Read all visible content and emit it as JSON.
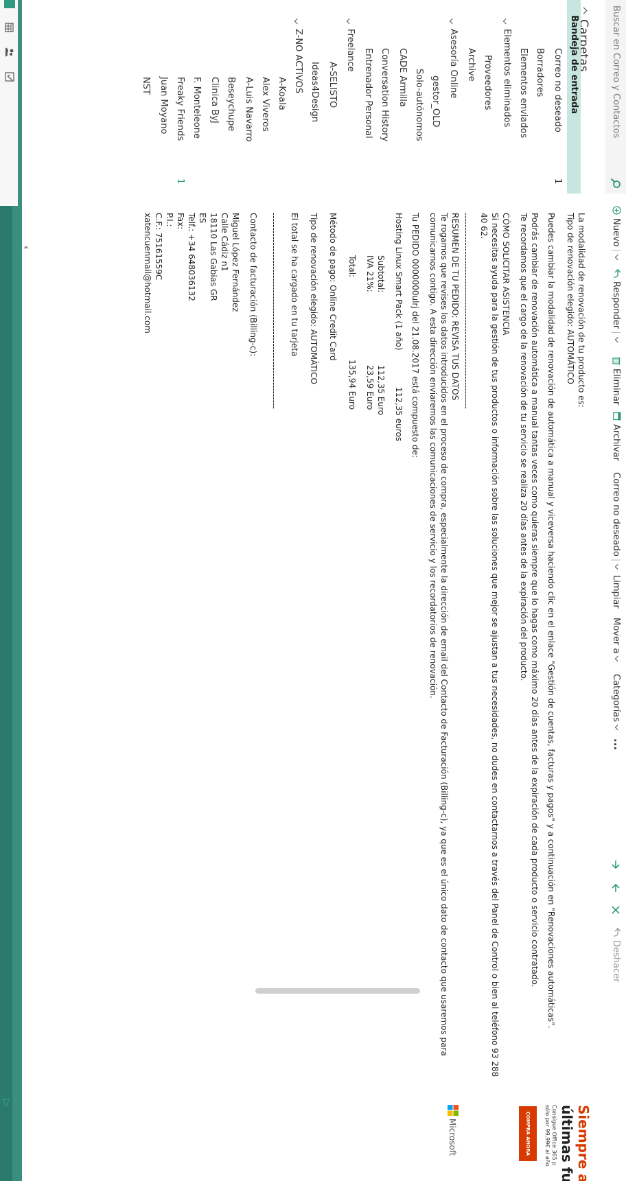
{
  "search": {
    "placeholder": "Buscar en Correo y Contactos"
  },
  "toolbar": {
    "new_label": "Nuevo",
    "reply_label": "Responder",
    "delete_label": "Eliminar",
    "archive_label": "Archivar",
    "junk_label": "Correo no deseado",
    "sweep_label": "Limpiar",
    "move_label": "Mover a",
    "categories_label": "Categorías",
    "more_label": "...",
    "undo_label": "Deshacer"
  },
  "folders": {
    "header": "Carpetas",
    "items": [
      {
        "label": "Bandeja de entrada",
        "count": "",
        "selected": true
      },
      {
        "label": "Correo no deseado",
        "count": "1"
      },
      {
        "label": "Borradores",
        "count": ""
      },
      {
        "label": "Elementos enviados",
        "count": ""
      },
      {
        "label": "Elementos eliminados",
        "count": ""
      },
      {
        "label": "Proveedores",
        "count": ""
      },
      {
        "label": "Archive",
        "count": ""
      },
      {
        "label": "Asesoría Online",
        "count": ""
      },
      {
        "label": "gestor_OLD",
        "count": ""
      },
      {
        "label": "Solo-autónomos",
        "count": ""
      },
      {
        "label": "CADE Armilla",
        "count": ""
      },
      {
        "label": "Conversation History",
        "count": ""
      },
      {
        "label": "Entrenador Personal",
        "count": ""
      },
      {
        "label": "Freelance",
        "count": ""
      },
      {
        "label": "A-SELISTO",
        "count": ""
      },
      {
        "label": "Ideas4Design",
        "count": ""
      },
      {
        "label": "Z-NO ACTIVOS",
        "count": ""
      },
      {
        "label": "A-Koala",
        "count": ""
      },
      {
        "label": "Alex Viveros",
        "count": ""
      },
      {
        "label": "A-Luis Navarro",
        "count": ""
      },
      {
        "label": "Beseychupe",
        "count": ""
      },
      {
        "label": "Clinica ByJ",
        "count": ""
      },
      {
        "label": "F. Monteleone",
        "count": ""
      },
      {
        "label": "Freaky Friends",
        "count": "1"
      },
      {
        "label": "Juan Moyano",
        "count": ""
      },
      {
        "label": "NST",
        "count": ""
      }
    ]
  },
  "email": {
    "lines": [
      "La modalidad de renovación de tu producto es:",
      "Tipo de renovación elegido: AUTOMÁTICO",
      "Puedes cambiar la modalidad de renovación de automática a manual y viceversa haciendo clic en el enlace \"Gestión de cuentas, facturas y pagos\" y a continuación en \"Renovaciones automáticas\".",
      "Podrás cambiar de renovación automática a manual tantas veces como quieras siempre que lo hagas como máximo 20 días antes de la expiración de cada producto o servicio contratado.",
      "Te recordamos que el cargo de la renovación de tu servicio se realiza 20 días antes de la expiración del producto.",
      "CÓMO SOLICITAR ASISTENCIA",
      "Si necesitas ayuda para la gestión de tus productos o información sobre las soluciones que mejor se ajustan a tus necesidades, no dudes en contactarnos a través del Panel de Control o bien al teléfono 93 288",
      "40 62.",
      "------------------------------------------------------------------",
      "RESUMEN DE TU PEDIDO: REVISA TUS DATOS",
      "Te rogamos que revises los datos introducidos en el proceso de compra, especialmente la dirección de email del Contacto de Facturación (Billing-c), ya que es el único dato de contacto que usaremos para",
      "comunicarnos contigo. A esta dirección enviaremos las comunicaciones de servicio y los recordatorios de renovación.",
      "Tu PEDIDO 0000000ulrj del 21.08.2017 está compuesto de:",
      "Hosting Linux Smart Pack (1 año)",
      "112,35 euros",
      "Subtotal:",
      "112,35 Euro",
      "IVA 21%:",
      "23,59 Euro",
      "Total:",
      "135,94 Euro",
      "Método de pago: Online Credit Card",
      "Tipo de renovación elegido: AUTOMÁTICO",
      "El total se ha cargado en tu tarjeta",
      "------------------------------------------------------------------",
      "Contacto de facturación (Billing-c):",
      "Miguel López Fernández",
      "Calle Cádiz n1",
      "18110 Las Gabias GR",
      "ES",
      "Telf.: +34 648036132",
      "Fax:",
      "P.I.:",
      "C.F.: 75161559C",
      "xatencuenmail@hotmail.com"
    ]
  },
  "ad": {
    "title_line1": "Siempre al",
    "title_line2": "últimas fu",
    "subtitle_line1": "Consigue Office 365 p",
    "subtitle_line2": "sólo por 99,99€ al año",
    "button_label": "COMPRA AHORA",
    "brand": "Microsoft"
  },
  "colors": {
    "accent": "#3a8f7e",
    "selected_folder": "#c7e6df",
    "icon_green": "#2e9a7f",
    "ad_orange": "#d83b01"
  }
}
